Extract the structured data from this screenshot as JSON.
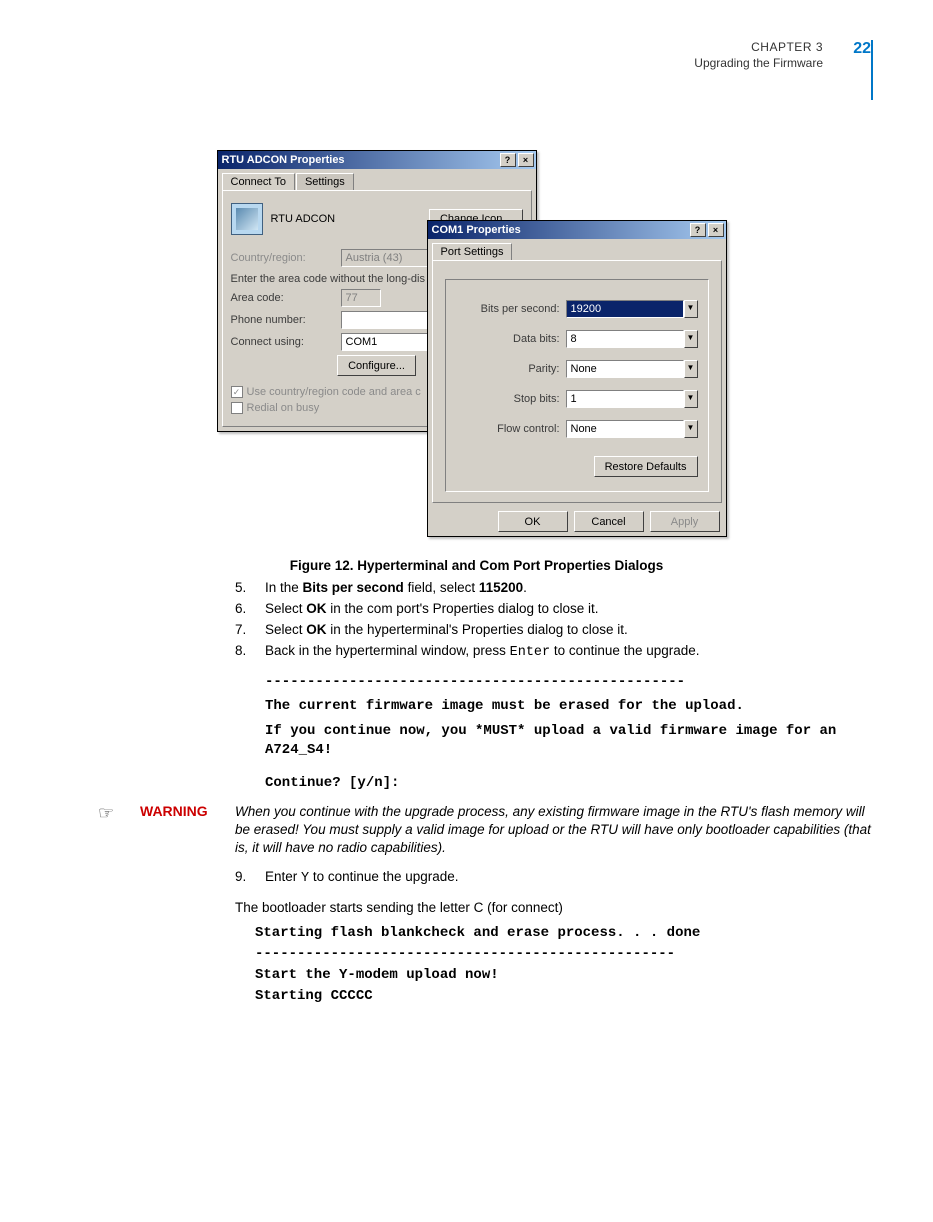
{
  "header": {
    "chapter": "CHAPTER 3",
    "subtitle": "Upgrading the Firmware",
    "page": "22"
  },
  "dialog1": {
    "title": "RTU ADCON Properties",
    "tab_connect": "Connect To",
    "tab_settings": "Settings",
    "name": "RTU ADCON",
    "change_icon": "Change Icon...",
    "country_lbl": "Country/region:",
    "country_val": "Austria (43)",
    "areacode_prompt": "Enter the area code without the long-dis",
    "area_lbl": "Area code:",
    "area_val": "77",
    "phone_lbl": "Phone number:",
    "phone_val": "",
    "connect_lbl": "Connect using:",
    "connect_val": "COM1",
    "configure": "Configure...",
    "chk1": "Use country/region code and area c",
    "chk2": "Redial on busy"
  },
  "dialog2": {
    "title": "COM1 Properties",
    "tab": "Port Settings",
    "bps_lbl": "Bits per second:",
    "bps_val": "19200",
    "databits_lbl": "Data bits:",
    "databits_val": "8",
    "parity_lbl": "Parity:",
    "parity_val": "None",
    "stopbits_lbl": "Stop bits:",
    "stopbits_val": "1",
    "flow_lbl": "Flow control:",
    "flow_val": "None",
    "restore": "Restore Defaults",
    "ok": "OK",
    "cancel": "Cancel",
    "apply": "Apply"
  },
  "caption": "Figure 12.  Hyperterminal and Com Port Properties Dialogs",
  "steps": {
    "s5_pre": "In the ",
    "s5_b1": "Bits per second",
    "s5_mid": " field, select ",
    "s5_b2": "115200",
    "s5_post": ".",
    "s6_pre": "Select ",
    "s6_b": "OK",
    "s6_post": " in the com port's Properties dialog to close it.",
    "s7_pre": "Select ",
    "s7_b": "OK",
    "s7_post": " in the hyperterminal's Properties dialog to close it.",
    "s8_pre": "Back in the hyperterminal window, press ",
    "s8_mono": "Enter",
    "s8_post": " to continue the upgrade.",
    "s9_pre": "Enter ",
    "s9_mono": "Y",
    "s9_post": " to continue the upgrade."
  },
  "terminal1": {
    "l1": "--------------------------------------------------",
    "l2": "The current firmware image must be erased for the upload.",
    "l3": "If you continue now, you *MUST* upload a valid firmware image for an A724_S4!",
    "l4": "Continue? [y/n]:"
  },
  "warning": {
    "icon": "☞",
    "label": "WARNING",
    "text": "When you continue with the upgrade process, any existing firmware image in the RTU's flash memory will be erased! You must supply a valid image for upload or the RTU will have only bootloader capabilities (that is, it will have no radio capabilities)."
  },
  "para": "The bootloader starts sending the letter C (for connect)",
  "terminal2": {
    "l1": "Starting flash blankcheck and erase process. . . done",
    "l2": "--------------------------------------------------",
    "l3": "Start the Y-modem upload now!",
    "l4": "Starting CCCCC"
  }
}
